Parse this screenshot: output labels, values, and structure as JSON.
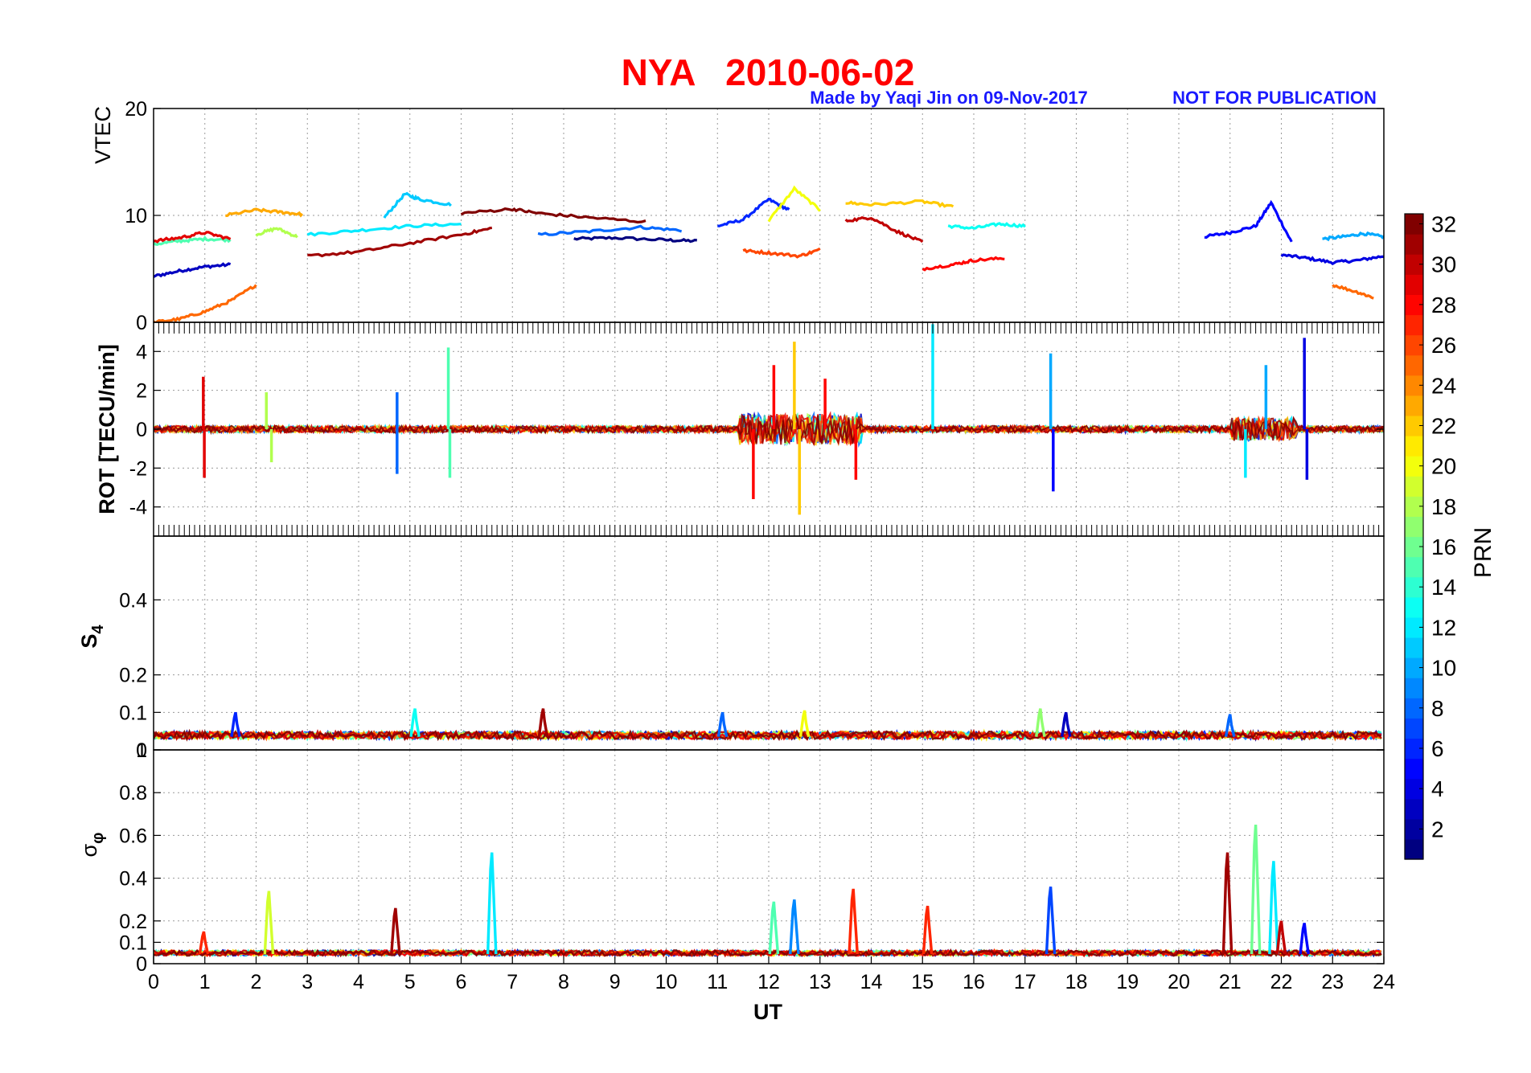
{
  "chart_data": {
    "type": "line",
    "title": "NYA   2010-06-02",
    "credit": "Made by Yaqi Jin on 09-Nov-2017",
    "notice": "NOT FOR PUBLICATION",
    "xlabel": "UT",
    "xlim": [
      0,
      24
    ],
    "xticks": [
      "0",
      "1",
      "2",
      "3",
      "4",
      "5",
      "6",
      "7",
      "8",
      "9",
      "10",
      "11",
      "12",
      "13",
      "14",
      "15",
      "16",
      "17",
      "18",
      "19",
      "20",
      "21",
      "22",
      "23",
      "24"
    ],
    "grid": true,
    "colormap": "jet",
    "colorbar": {
      "label": "PRN",
      "range": [
        1,
        32
      ],
      "ticks": [
        "2",
        "4",
        "6",
        "8",
        "10",
        "12",
        "14",
        "16",
        "18",
        "20",
        "22",
        "24",
        "26",
        "28",
        "30",
        "32"
      ],
      "levels": 32
    },
    "panels": [
      {
        "key": "vtec",
        "ylabel": "VTEC",
        "ylim": [
          0,
          20
        ],
        "yticks": [
          "0",
          "10",
          "20"
        ],
        "series": [
          {
            "prn": 1,
            "x": [
              8.2,
              9.0,
              10.0,
              10.6
            ],
            "y": [
              7.8,
              7.9,
              7.7,
              7.6
            ]
          },
          {
            "prn": 3,
            "x": [
              0.0,
              0.5,
              1.0,
              1.5
            ],
            "y": [
              4.3,
              4.8,
              5.2,
              5.4
            ]
          },
          {
            "prn": 4,
            "x": [
              22.0,
              22.5,
              23.0,
              23.5,
              24.0
            ],
            "y": [
              6.3,
              6.0,
              5.6,
              5.8,
              6.2
            ]
          },
          {
            "prn": 5,
            "x": [
              20.5,
              21.0,
              21.5,
              21.8,
              22.2
            ],
            "y": [
              8.0,
              8.4,
              9.0,
              11.2,
              7.5
            ]
          },
          {
            "prn": 6,
            "x": [
              11.0,
              11.5,
              12.0,
              12.4
            ],
            "y": [
              9.0,
              9.6,
              11.5,
              10.5
            ]
          },
          {
            "prn": 8,
            "x": [
              7.5,
              8.5,
              9.5,
              10.3
            ],
            "y": [
              8.2,
              8.5,
              8.9,
              8.6
            ]
          },
          {
            "prn": 10,
            "x": [
              22.8,
              23.2,
              23.6,
              24.0
            ],
            "y": [
              7.8,
              8.0,
              8.3,
              8.0
            ]
          },
          {
            "prn": 11,
            "x": [
              4.5,
              4.9,
              5.2,
              5.8
            ],
            "y": [
              9.8,
              12.0,
              11.5,
              11.0
            ]
          },
          {
            "prn": 12,
            "x": [
              3.0,
              4.0,
              5.0,
              6.0
            ],
            "y": [
              8.2,
              8.6,
              9.0,
              9.2
            ]
          },
          {
            "prn": 13,
            "x": [
              15.5,
              16.0,
              16.5,
              17.0
            ],
            "y": [
              9.0,
              8.8,
              9.2,
              9.0
            ]
          },
          {
            "prn": 15,
            "x": [
              0.0,
              0.5,
              1.0,
              1.5
            ],
            "y": [
              7.3,
              7.6,
              7.8,
              7.7
            ]
          },
          {
            "prn": 18,
            "x": [
              2.0,
              2.4,
              2.8
            ],
            "y": [
              8.2,
              8.8,
              8.0
            ]
          },
          {
            "prn": 20,
            "x": [
              12.0,
              12.5,
              13.0
            ],
            "y": [
              9.5,
              12.5,
              10.5
            ]
          },
          {
            "prn": 22,
            "x": [
              13.5,
              14.0,
              15.0,
              15.6
            ],
            "y": [
              11.2,
              11.0,
              11.3,
              10.8
            ]
          },
          {
            "prn": 23,
            "x": [
              1.4,
              2.0,
              2.5,
              2.9
            ],
            "y": [
              10.0,
              10.5,
              10.3,
              10.1
            ]
          },
          {
            "prn": 25,
            "x": [
              0.0,
              0.5,
              1.0,
              1.5,
              2.0
            ],
            "y": [
              0.0,
              0.3,
              1.0,
              2.0,
              3.5
            ]
          },
          {
            "prn": 25,
            "x": [
              23.0,
              23.5,
              23.8
            ],
            "y": [
              3.5,
              2.8,
              2.3
            ]
          },
          {
            "prn": 26,
            "x": [
              11.5,
              12.0,
              12.6,
              13.0
            ],
            "y": [
              6.7,
              6.5,
              6.2,
              6.8
            ]
          },
          {
            "prn": 28,
            "x": [
              15.0,
              15.6,
              16.0,
              16.6
            ],
            "y": [
              5.0,
              5.4,
              5.8,
              6.0
            ]
          },
          {
            "prn": 29,
            "x": [
              0.0,
              0.5,
              1.0,
              1.5
            ],
            "y": [
              7.6,
              7.9,
              8.4,
              7.8
            ]
          },
          {
            "prn": 30,
            "x": [
              13.5,
              14.0,
              14.5,
              15.0
            ],
            "y": [
              9.5,
              9.8,
              8.5,
              7.5
            ]
          },
          {
            "prn": 31,
            "x": [
              3.0,
              4.0,
              5.0,
              6.0,
              6.6
            ],
            "y": [
              6.2,
              6.6,
              7.4,
              8.2,
              8.8
            ]
          },
          {
            "prn": 32,
            "x": [
              6.0,
              7.0,
              7.5,
              8.5,
              9.6
            ],
            "y": [
              10.2,
              10.6,
              10.2,
              9.8,
              9.4
            ]
          }
        ]
      },
      {
        "key": "rot",
        "ylabel": "ROT [TECU/min]",
        "ylim": [
          -5.5,
          5.5
        ],
        "yticks": [
          "-4",
          "-2",
          "0",
          "2",
          "4"
        ],
        "spikes": [
          {
            "prn": 29,
            "x": 0.97,
            "y": 2.7
          },
          {
            "prn": 29,
            "x": 0.99,
            "y": -2.5
          },
          {
            "prn": 18,
            "x": 2.2,
            "y": 1.9
          },
          {
            "prn": 18,
            "x": 2.3,
            "y": -1.7
          },
          {
            "prn": 8,
            "x": 4.75,
            "y": 1.9
          },
          {
            "prn": 8,
            "x": 4.75,
            "y": -2.3
          },
          {
            "prn": 15,
            "x": 5.75,
            "y": 4.2
          },
          {
            "prn": 15,
            "x": 5.78,
            "y": -2.5
          },
          {
            "prn": 28,
            "x": 11.7,
            "y": -3.6
          },
          {
            "prn": 28,
            "x": 12.1,
            "y": 3.3
          },
          {
            "prn": 22,
            "x": 12.5,
            "y": 4.5
          },
          {
            "prn": 22,
            "x": 12.6,
            "y": -4.4
          },
          {
            "prn": 28,
            "x": 13.1,
            "y": 2.6
          },
          {
            "prn": 28,
            "x": 13.7,
            "y": -2.6
          },
          {
            "prn": 12,
            "x": 15.2,
            "y": 5.4
          },
          {
            "prn": 10,
            "x": 17.5,
            "y": 3.9
          },
          {
            "prn": 5,
            "x": 17.55,
            "y": -3.2
          },
          {
            "prn": 12,
            "x": 21.3,
            "y": -2.5
          },
          {
            "prn": 10,
            "x": 21.7,
            "y": 3.3
          },
          {
            "prn": 4,
            "x": 22.45,
            "y": 4.7
          },
          {
            "prn": 4,
            "x": 22.5,
            "y": -2.6
          }
        ]
      },
      {
        "key": "s4",
        "ylabel": "S4",
        "ylim": [
          0,
          0.57
        ],
        "yticks": [
          "0",
          "0.1",
          "0.2",
          "0.4"
        ],
        "peaks": [
          {
            "prn": 6,
            "x": 1.6,
            "y": 0.1
          },
          {
            "prn": 13,
            "x": 5.1,
            "y": 0.11
          },
          {
            "prn": 31,
            "x": 7.6,
            "y": 0.11
          },
          {
            "prn": 8,
            "x": 11.1,
            "y": 0.1
          },
          {
            "prn": 20,
            "x": 12.7,
            "y": 0.105
          },
          {
            "prn": 17,
            "x": 17.3,
            "y": 0.11
          },
          {
            "prn": 3,
            "x": 17.8,
            "y": 0.1
          },
          {
            "prn": 8,
            "x": 21.0,
            "y": 0.095
          }
        ]
      },
      {
        "key": "sigma_phi",
        "ylabel": "σφ",
        "ylim": [
          0,
          1
        ],
        "yticks": [
          "0",
          "0.1",
          "0.2",
          "0.4",
          "0.6",
          "0.8",
          "1"
        ],
        "peaks": [
          {
            "prn": 27,
            "x": 0.98,
            "y": 0.15
          },
          {
            "prn": 19,
            "x": 2.25,
            "y": 0.34
          },
          {
            "prn": 31,
            "x": 4.72,
            "y": 0.26
          },
          {
            "prn": 12,
            "x": 6.6,
            "y": 0.52
          },
          {
            "prn": 15,
            "x": 12.1,
            "y": 0.29
          },
          {
            "prn": 9,
            "x": 12.5,
            "y": 0.3
          },
          {
            "prn": 27,
            "x": 13.65,
            "y": 0.35
          },
          {
            "prn": 27,
            "x": 15.1,
            "y": 0.27
          },
          {
            "prn": 7,
            "x": 17.5,
            "y": 0.36
          },
          {
            "prn": 31,
            "x": 20.95,
            "y": 0.52
          },
          {
            "prn": 16,
            "x": 21.5,
            "y": 0.65
          },
          {
            "prn": 12,
            "x": 21.85,
            "y": 0.48
          },
          {
            "prn": 30,
            "x": 22.0,
            "y": 0.2
          },
          {
            "prn": 5,
            "x": 22.45,
            "y": 0.19
          }
        ]
      }
    ]
  }
}
